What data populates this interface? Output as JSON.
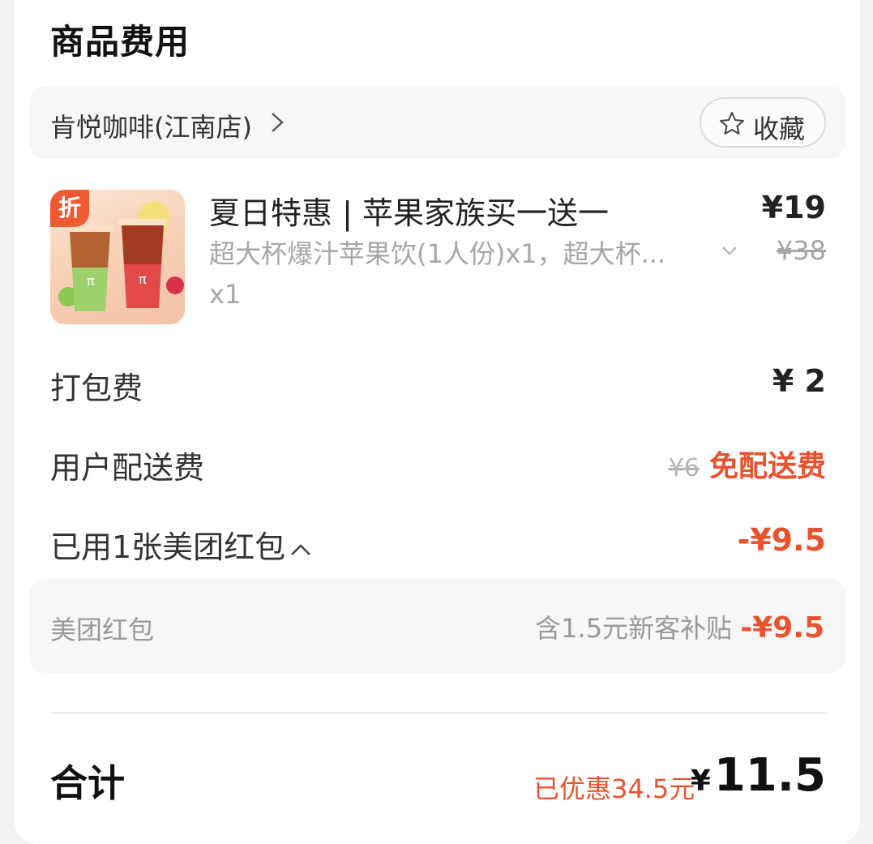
{
  "section_title": "商品费用",
  "shop": {
    "name": "肯悦咖啡(江南店)",
    "favorite_label": "收藏"
  },
  "product": {
    "badge": "折",
    "name": "夏日特惠 | 苹果家族买一送一",
    "desc": "超大杯爆汁苹果饮(1人份)x1，超大杯...",
    "qty": "x1",
    "price": "¥19",
    "original_price": "¥38"
  },
  "packing": {
    "label": "打包费",
    "value": "¥ 2"
  },
  "delivery": {
    "label": "用户配送费",
    "original": "¥6",
    "value": "免配送费"
  },
  "coupon": {
    "label": "已用1张美团红包",
    "value": "-¥9.5",
    "detail_label": "美团红包",
    "detail_note": "含1.5元新客补贴",
    "detail_value": "-¥9.5"
  },
  "total": {
    "label": "合计",
    "saved": "已优惠34.5元",
    "currency": "¥",
    "amount": "11.5"
  },
  "colors": {
    "accent": "#e8532f",
    "muted": "#a6a6a6"
  }
}
